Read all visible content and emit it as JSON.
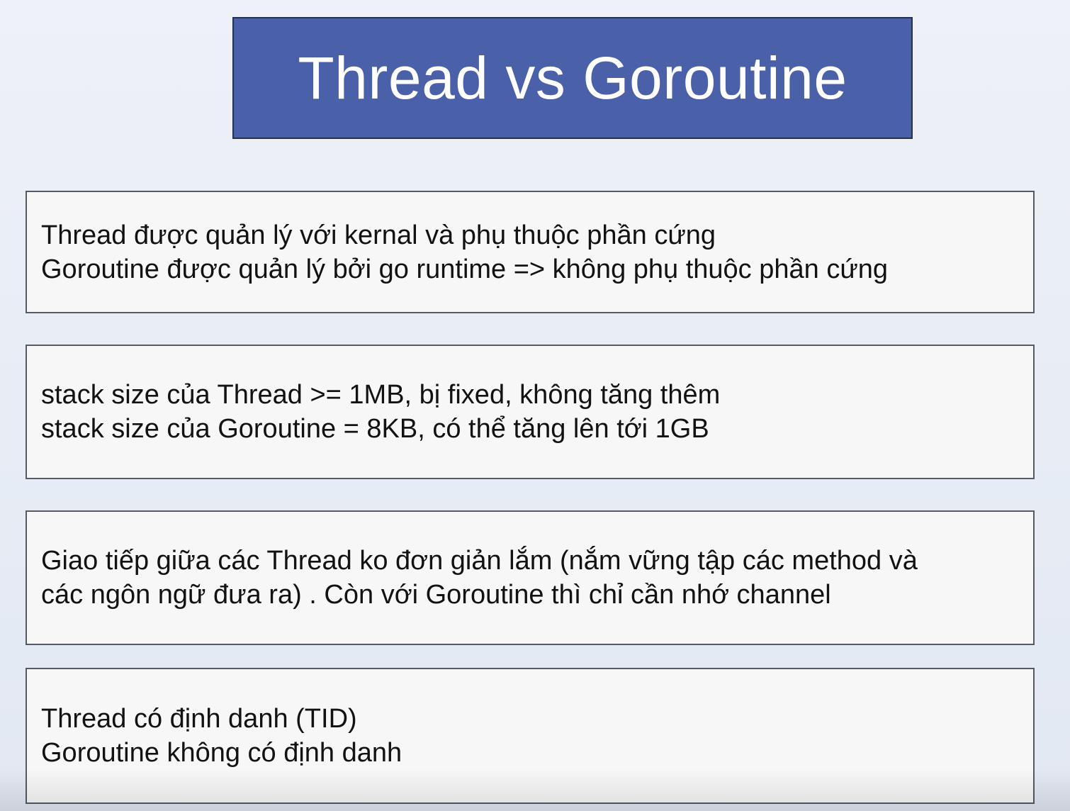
{
  "slide": {
    "title": "Thread vs Goroutine",
    "cards": [
      {
        "lines": [
          "Thread được quản lý với kernal và phụ thuộc phần cứng",
          "Goroutine được quản lý bởi go runtime => không phụ thuộc phần cứng"
        ]
      },
      {
        "lines": [
          "stack size của Thread >= 1MB, bị fixed, không tăng thêm",
          "stack size của Goroutine = 8KB, có thể tăng lên tới 1GB"
        ]
      },
      {
        "lines": [
          "Giao tiếp giữa các Thread ko đơn giản lắm (nắm vững tập các method và",
          "các ngôn ngữ đưa ra) . Còn với Goroutine thì chỉ cần nhớ channel"
        ]
      },
      {
        "lines": [
          "Thread có định danh (TID)",
          "Goroutine không có định danh"
        ]
      }
    ]
  },
  "colors": {
    "title_background": "#4a60a8",
    "title_text": "#ffffff",
    "card_background": "#f7f7f7",
    "card_border": "#555a63",
    "page_background": "#e9edf5"
  }
}
